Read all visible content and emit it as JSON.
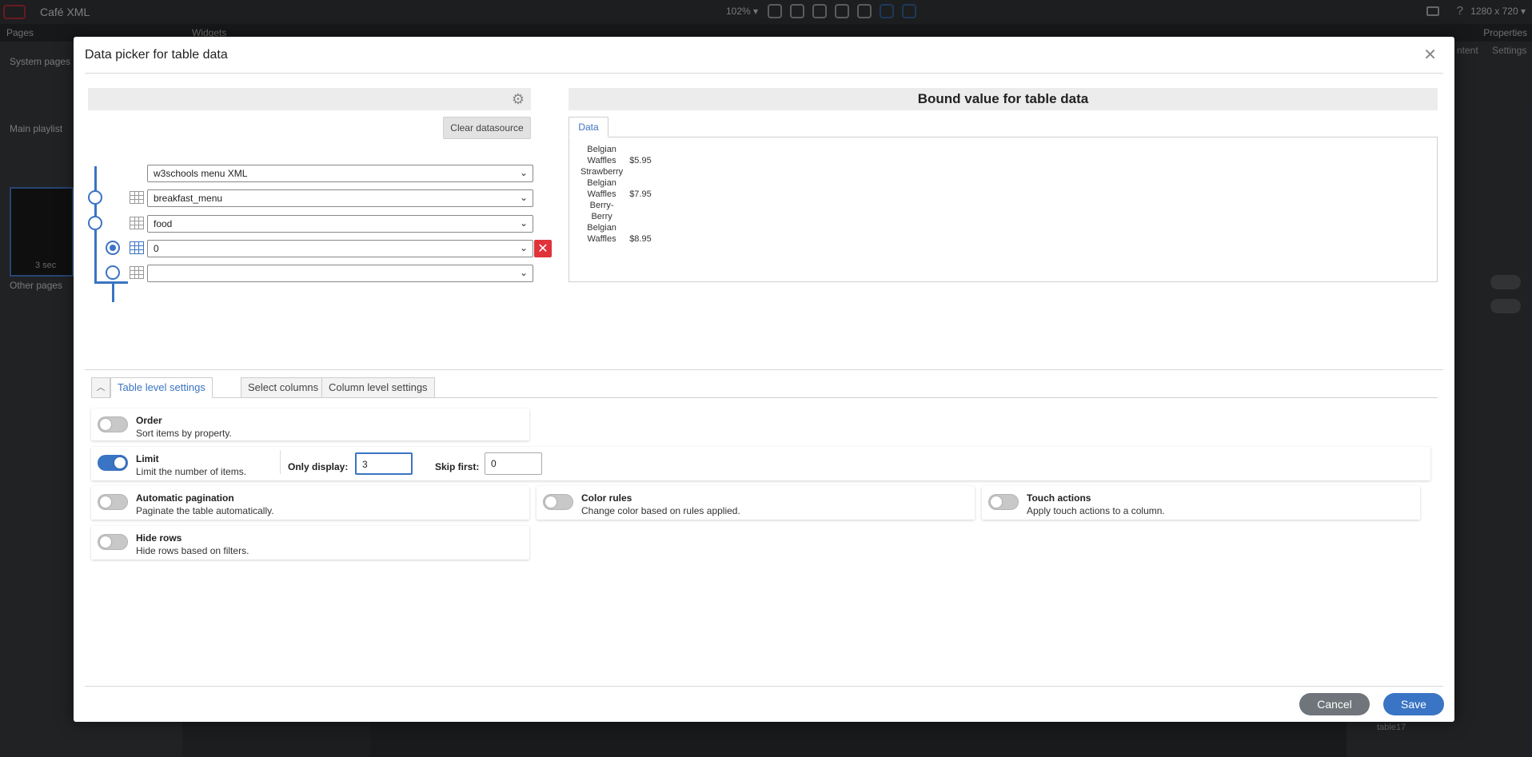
{
  "app": {
    "title": "Café XML",
    "zoom": "102%",
    "resolution": "1280 x 720",
    "pages_label": "Pages",
    "widgets_label": "Widgets",
    "properties_label": "Properties",
    "sections": {
      "system_pages": "System pages",
      "main_playlist": "Main playlist",
      "other_pages": "Other pages"
    },
    "thumb_duration": "3 sec",
    "right_tabs": {
      "content": "ntent",
      "settings": "Settings"
    },
    "layer_label": "table17"
  },
  "modal": {
    "title": "Data picker for table data",
    "clear_datasource_label": "Clear datasource",
    "selectors": [
      {
        "value": "w3schools menu XML"
      },
      {
        "value": "breakfast_menu"
      },
      {
        "value": "food"
      },
      {
        "value": "0"
      },
      {
        "value": ""
      }
    ],
    "bound_title": "Bound value for table data",
    "data_tab_label": "Data",
    "data_rows": [
      {
        "name": [
          "Belgian",
          "Waffles"
        ],
        "price": "$5.95"
      },
      {
        "name": [
          "Strawberry",
          "Belgian",
          "Waffles"
        ],
        "price": "$7.95"
      },
      {
        "name": [
          "Berry-",
          "Berry",
          "Belgian",
          "Waffles"
        ],
        "price": "$8.95"
      }
    ],
    "settings_tabs": [
      "Table level settings",
      "Select columns",
      "Column level settings"
    ],
    "settings": {
      "order": {
        "title": "Order",
        "desc": "Sort items by property.",
        "enabled": false
      },
      "limit": {
        "title": "Limit",
        "desc": "Limit the number of items.",
        "enabled": true,
        "only_display_label": "Only display:",
        "only_display_value": "3",
        "skip_first_label": "Skip first:",
        "skip_first_value": "0"
      },
      "pagination": {
        "title": "Automatic pagination",
        "desc": "Paginate the table automatically.",
        "enabled": false
      },
      "color_rules": {
        "title": "Color rules",
        "desc": "Change color based on rules applied.",
        "enabled": false
      },
      "touch_actions": {
        "title": "Touch actions",
        "desc": "Apply touch actions to a column.",
        "enabled": false
      },
      "hide_rows": {
        "title": "Hide rows",
        "desc": "Hide rows based on filters.",
        "enabled": false
      }
    },
    "cancel_label": "Cancel",
    "save_label": "Save"
  },
  "colors": {
    "accent": "#3a74c4",
    "danger": "#e0323b",
    "cancel": "#6f757a"
  }
}
